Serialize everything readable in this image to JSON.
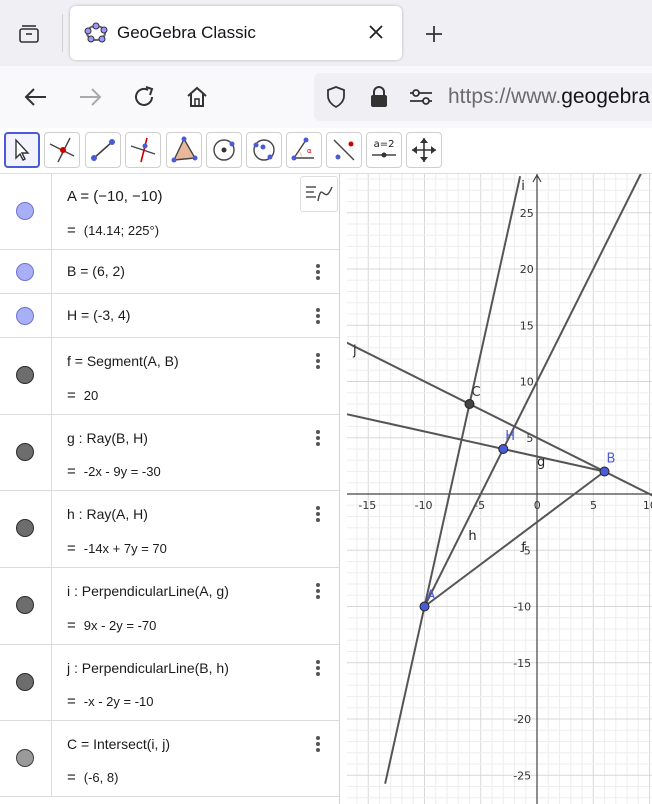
{
  "browser": {
    "tab_title": "GeoGebra Classic",
    "url_prefix": "https://www.",
    "url_domain": "geogebra"
  },
  "toolbar": {
    "tools": [
      "move-tool",
      "point-tool",
      "segment-tool",
      "perpendicular-line-tool",
      "polygon-tool",
      "circle-tool",
      "conic-tool",
      "angle-tool",
      "reflect-tool",
      "slider-tool",
      "move-graphics-tool"
    ],
    "slider_label": "a=2"
  },
  "algebra": {
    "rows": [
      {
        "def": "A = (−10, −10)",
        "val": "(14.14; 225°)",
        "marble": "blue"
      },
      {
        "def": "B = (6, 2)",
        "val": "",
        "marble": "blue"
      },
      {
        "def": "H = (-3, 4)",
        "val": "",
        "marble": "blue"
      },
      {
        "def": "f = Segment(A, B)",
        "val": "20",
        "marble": "dark"
      },
      {
        "def": "g : Ray(B, H)",
        "val": "-2x - 9y = -30",
        "marble": "dark"
      },
      {
        "def": "h : Ray(A, H)",
        "val": "-14x + 7y = 70",
        "marble": "dark"
      },
      {
        "def": "i : PerpendicularLine(A, g)",
        "val": "9x - 2y = -70",
        "marble": "dark"
      },
      {
        "def": "j : PerpendicularLine(B, h)",
        "val": "-x - 2y = -10",
        "marble": "dark"
      },
      {
        "def": "C = Intersect(i, j)",
        "val": "(-6, 8)",
        "marble": "light"
      }
    ],
    "eq_sign": "="
  },
  "graphics": {
    "x_ticks": [
      "-15",
      "-10",
      "-5",
      "0",
      "5",
      "10"
    ],
    "y_ticks": [
      "25",
      "20",
      "15",
      "10",
      "5",
      "-5",
      "-10",
      "-15",
      "-20",
      "-25"
    ],
    "axis_labels": {
      "i": "i",
      "j": "j",
      "g": "g",
      "h": "h",
      "f": "f"
    },
    "points": [
      {
        "name": "A",
        "x": -10,
        "y": -10,
        "color": "#4a5bd6"
      },
      {
        "name": "B",
        "x": 6,
        "y": 2,
        "color": "#4a5bd6"
      },
      {
        "name": "H",
        "x": -3,
        "y": 4,
        "color": "#4a5bd6"
      },
      {
        "name": "C",
        "x": -6,
        "y": 8,
        "color": "#333333"
      }
    ],
    "colors": {
      "grid_minor": "#eeeeee",
      "grid_major": "#d8d8d8",
      "line": "#555555",
      "point": "#4a5bd6"
    }
  }
}
